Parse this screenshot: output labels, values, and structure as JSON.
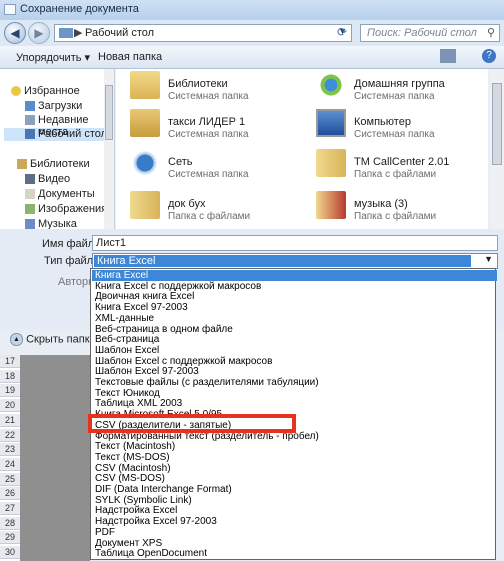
{
  "window": {
    "title": "Сохранение документа"
  },
  "navigation": {
    "back": "◀",
    "forward": "▶",
    "address": "Рабочий стол",
    "address_sep": "▶",
    "search_placeholder": "Поиск: Рабочий стол"
  },
  "toolbar": {
    "organize": "Упорядочить ▾",
    "new_folder": "Новая папка"
  },
  "navpane": {
    "items": [
      {
        "label": "Избранное",
        "icon": "star-icon"
      },
      {
        "label": "Загрузки",
        "icon": "downloads-icon"
      },
      {
        "label": "Недавние места",
        "icon": "recent-places-icon"
      },
      {
        "label": "Рабочий стол",
        "icon": "desktop-icon",
        "selected": true
      },
      {
        "label": "Библиотеки",
        "icon": "library-icon"
      },
      {
        "label": "Видео",
        "icon": "video-icon"
      },
      {
        "label": "Документы",
        "icon": "documents-icon"
      },
      {
        "label": "Изображения",
        "icon": "pictures-icon"
      },
      {
        "label": "Музыка",
        "icon": "music-icon"
      }
    ]
  },
  "files": [
    {
      "name": "Библиотеки",
      "type": "Системная папка",
      "icon": "libraries-folder-icon"
    },
    {
      "name": "Домашняя группа",
      "type": "Системная папка",
      "icon": "homegroup-icon"
    },
    {
      "name": "такси ЛИДЕР 1",
      "type": "Системная папка",
      "icon": "user-folder-icon"
    },
    {
      "name": "Компьютер",
      "type": "Системная папка",
      "icon": "computer-icon"
    },
    {
      "name": "Сеть",
      "type": "Системная папка",
      "icon": "network-icon"
    },
    {
      "name": "TM CallCenter 2.01",
      "type": "Папка с файлами",
      "icon": "folder-icon"
    },
    {
      "name": "док бух",
      "type": "Папка с файлами",
      "icon": "folder-icon"
    },
    {
      "name": "музыка (3)",
      "type": "Папка с файлами",
      "icon": "folder-icon"
    }
  ],
  "form": {
    "filename_label": "Имя файла:",
    "filename_value": "Лист1",
    "filetype_label": "Тип файла:",
    "filetype_value": "Книга Excel",
    "authors_label": "Авторы",
    "hide_folders": "Скрыть папки"
  },
  "excel": {
    "rows": [
      "17",
      "18",
      "19",
      "20",
      "21",
      "22",
      "23",
      "24",
      "25",
      "26",
      "27",
      "28",
      "29",
      "30"
    ]
  },
  "filetype_options": [
    "Книга Excel",
    "Книга Excel с поддержкой макросов",
    "Двоичная книга Excel",
    "Книга Excel 97-2003",
    "XML-данные",
    "Веб-страница в одном файле",
    "Веб-страница",
    "Шаблон Excel",
    "Шаблон Excel с поддержкой макросов",
    "Шаблон Excel 97-2003",
    "Текстовые файлы (с разделителями табуляции)",
    "Текст Юникод",
    "Таблица XML 2003",
    "Книга Microsoft Excel 5.0/95",
    "CSV (разделители - запятые)",
    "Форматированный текст (разделитель - пробел)",
    "Текст (Macintosh)",
    "Текст (MS-DOS)",
    "CSV (Macintosh)",
    "CSV (MS-DOS)",
    "DIF (Data Interchange Format)",
    "SYLK (Symbolic Link)",
    "Надстройка Excel",
    "Надстройка Excel 97-2003",
    "PDF",
    "Документ XPS",
    "Таблица OpenDocument"
  ],
  "selected_option_index": 0,
  "colors": {
    "selection": "#3c87d9",
    "highlight_box": "#e8321b"
  }
}
